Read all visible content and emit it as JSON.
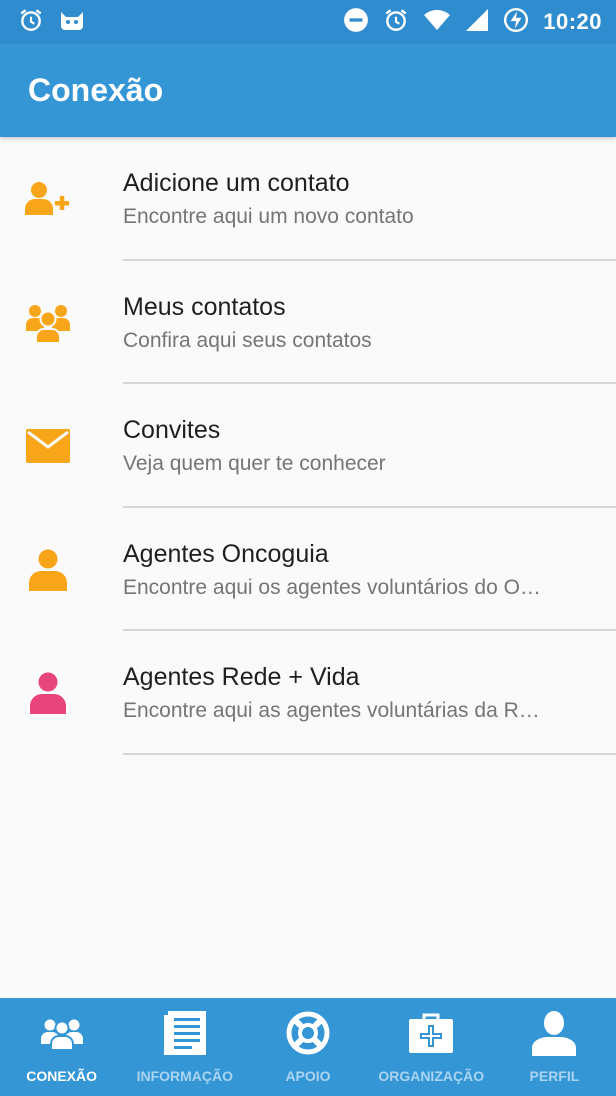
{
  "status_bar": {
    "time": "10:20",
    "icons": [
      "alarm-icon",
      "cat-icon",
      "do-not-disturb-icon",
      "alarm-icon",
      "wifi-icon",
      "signal-icon",
      "battery-charging-icon"
    ]
  },
  "app_bar": {
    "title": "Conexão"
  },
  "list": {
    "items": [
      {
        "title": "Adicione um contato",
        "subtitle": "Encontre aqui um novo contato",
        "icon": "add-contact-icon",
        "icon_color": "#f9a51a"
      },
      {
        "title": "Meus contatos",
        "subtitle": "Confira aqui seus contatos",
        "icon": "group-icon",
        "icon_color": "#f9a51a"
      },
      {
        "title": "Convites",
        "subtitle": "Veja quem quer te conhecer",
        "icon": "envelope-icon",
        "icon_color": "#f9a51a"
      },
      {
        "title": "Agentes Oncoguia",
        "subtitle": "Encontre aqui os agentes voluntários do O…",
        "icon": "person-icon",
        "icon_color": "#f9a51a"
      },
      {
        "title": "Agentes Rede + Vida",
        "subtitle": "Encontre aqui as agentes voluntárias da R…",
        "icon": "person-icon",
        "icon_color": "#e8457d"
      }
    ]
  },
  "bottom_nav": {
    "items": [
      {
        "label": "CONEXÃO",
        "icon": "people-icon",
        "active": true
      },
      {
        "label": "INFORMAÇÃO",
        "icon": "document-icon",
        "active": false
      },
      {
        "label": "APOIO",
        "icon": "lifebuoy-icon",
        "active": false
      },
      {
        "label": "ORGANIZAÇÃO",
        "icon": "medical-kit-icon",
        "active": false
      },
      {
        "label": "PERFIL",
        "icon": "person-icon",
        "active": false
      }
    ]
  },
  "colors": {
    "primary": "#3596d6",
    "status_bar": "#2f8ccf",
    "accent_orange": "#f9a51a",
    "accent_pink": "#e8457d",
    "nav_inactive": "#a9d4f2"
  }
}
